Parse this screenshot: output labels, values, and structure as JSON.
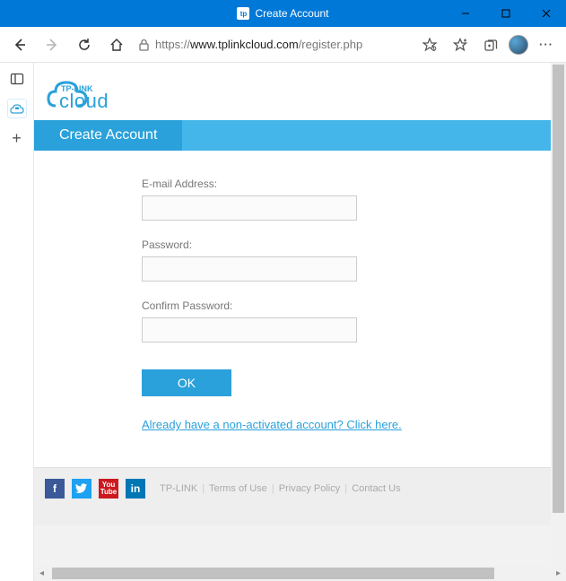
{
  "window": {
    "tab_title": "Create Account"
  },
  "toolbar": {
    "url_host": "www.tplinkcloud.com",
    "url_path": "/register.php",
    "url_prefix": "https://"
  },
  "logo": {
    "brand_top": "TP-LINK",
    "brand_bottom": "cloud"
  },
  "page": {
    "heading": "Create Account",
    "email_label": "E-mail Address:",
    "password_label": "Password:",
    "confirm_label": "Confirm Password:",
    "email_value": "",
    "password_value": "",
    "confirm_value": "",
    "submit_label": "OK",
    "activate_link": "Already have a non-activated account? Click here."
  },
  "footer": {
    "links": [
      "TP-LINK",
      "Terms of Use",
      "Privacy Policy",
      "Contact Us"
    ]
  }
}
